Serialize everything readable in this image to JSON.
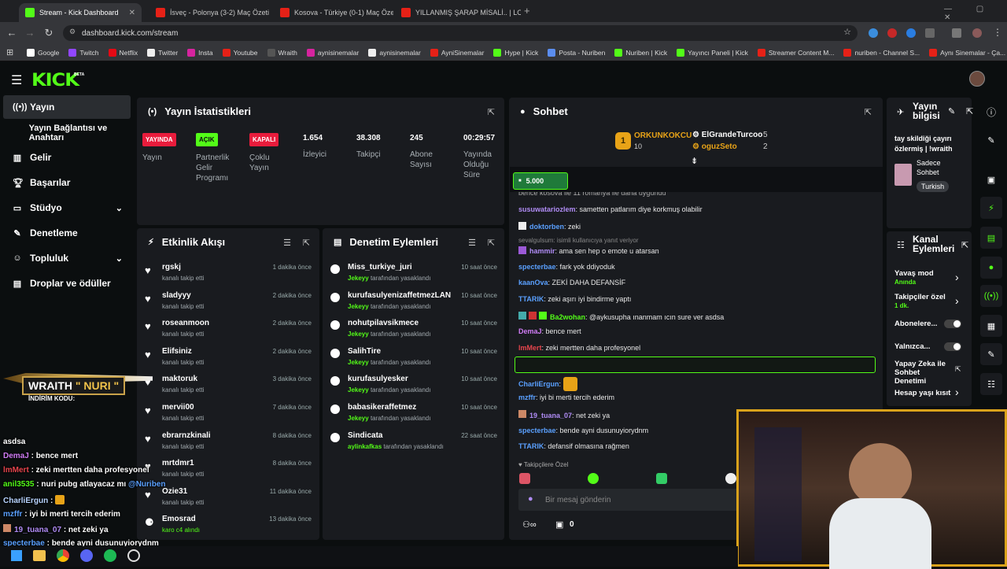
{
  "browser": {
    "tabs": [
      {
        "title": "Stream - Kick Dashboard",
        "active": true,
        "favicon": "kick-logo-icon"
      },
      {
        "title": "İsveç - Polonya (3-2) Maç Özeti",
        "active": false,
        "favicon": "youtube-icon"
      },
      {
        "title": "Kosova - Türkiye (0-1) Maç Özeti",
        "active": false,
        "favicon": "youtube-icon"
      },
      {
        "title": "YILLANMIŞ ŞARAP MİSALİ.. | LC",
        "active": false,
        "favicon": "youtube-icon"
      }
    ],
    "url": "dashboard.kick.com/stream",
    "bookmarks": [
      "Google",
      "Twitch",
      "Netflix",
      "Twitter",
      "Insta",
      "Youtube",
      "Wraith",
      "aynisinemalar",
      "aynisinemalar",
      "AyniSinemalar",
      "Hype | Kick",
      "Posta - Nuriben",
      "Nuriben | Kick",
      "Yayıncı Paneli | Kick",
      "Streamer Content M...",
      "nuriben - Channel S...",
      "Aynı Sinemalar - Ça..."
    ]
  },
  "logo": "KICK",
  "logo_beta": "BETA",
  "sidebar": {
    "items": [
      {
        "label": "Yayın",
        "icon": "broadcast-icon",
        "active": true
      },
      {
        "label": "Yayın Bağlantısı ve Anahtarı",
        "icon": "",
        "active": false
      },
      {
        "label": "Gelir",
        "icon": "chart-icon",
        "active": false
      },
      {
        "label": "Başarılar",
        "icon": "trophy-icon",
        "active": false
      },
      {
        "label": "Stüdyo",
        "icon": "studio-icon",
        "active": false,
        "chevron": true
      },
      {
        "label": "Denetleme",
        "icon": "wrench-icon",
        "active": false
      },
      {
        "label": "Topluluk",
        "icon": "users-icon",
        "active": false,
        "chevron": true
      },
      {
        "label": "Droplar ve ödüller",
        "icon": "gift-icon",
        "active": false
      }
    ]
  },
  "stats": {
    "title": "Yayın İstatistikleri",
    "badges": [
      {
        "badge": "YAYINDA",
        "label": "Yayın",
        "color": "#e81c3c"
      },
      {
        "badge": "AÇIK",
        "label": "Partnerlik Gelir Programı",
        "color": "#53fc18"
      },
      {
        "badge": "KAPALI",
        "label": "Çoklu Yayın",
        "color": "#e81c3c"
      }
    ],
    "values": [
      {
        "value": "1.654",
        "label": "İzleyici"
      },
      {
        "value": "38.308",
        "label": "Takipçi"
      },
      {
        "value": "245",
        "label": "Abone Sayısı"
      },
      {
        "value": "00:29:57",
        "label": "Yayında Olduğu Süre"
      }
    ]
  },
  "activity": {
    "title": "Etkinlik Akışı",
    "rows": [
      {
        "name": "rgskj",
        "sub": "kanalı takip etti",
        "time": "1 dakika önce"
      },
      {
        "name": "sladyyy",
        "sub": "kanalı takip etti",
        "time": "2 dakika önce"
      },
      {
        "name": "roseanmoon",
        "sub": "kanalı takip etti",
        "time": "2 dakika önce"
      },
      {
        "name": "Elifsiniz",
        "sub": "kanalı takip etti",
        "time": "2 dakika önce"
      },
      {
        "name": "maktoruk",
        "sub": "kanalı takip etti",
        "time": "3 dakika önce"
      },
      {
        "name": "mervii00",
        "sub": "kanalı takip etti",
        "time": "7 dakika önce"
      },
      {
        "name": "ebrarnzkinali",
        "sub": "kanalı takip etti",
        "time": "8 dakika önce"
      },
      {
        "name": "mrtdmr1",
        "sub": "kanalı takip etti",
        "time": "8 dakika önce"
      },
      {
        "name": "Ozie31",
        "sub": "kanalı takip etti",
        "time": "11 dakika önce"
      },
      {
        "name": "Emosrad",
        "sub": "karo c4 alındı",
        "time": "13 dakika önce"
      }
    ]
  },
  "moderation": {
    "title": "Denetim Eylemleri",
    "suffix": "tarafından yasaklandı",
    "rows": [
      {
        "name": "Miss_turkiye_juri",
        "by": "Jekeyy",
        "time": "10 saat önce"
      },
      {
        "name": "kurufasulyenizaffetmezLAN",
        "by": "Jekeyy",
        "time": "10 saat önce"
      },
      {
        "name": "nohutpilavsikmece",
        "by": "Jekeyy",
        "time": "10 saat önce"
      },
      {
        "name": "SalihTire",
        "by": "Jekeyy",
        "time": "10 saat önce"
      },
      {
        "name": "kurufasulyesker",
        "by": "Jekeyy",
        "time": "10 saat önce"
      },
      {
        "name": "babasikeraffetmez",
        "by": "Jekeyy",
        "time": "10 saat önce"
      },
      {
        "name": "Sindicata",
        "by": "aylinkafkas",
        "time": "22 saat önce"
      }
    ]
  },
  "chat": {
    "title": "Sohbet",
    "leaderboard": {
      "first": {
        "rank": "1",
        "name": "ORKUNKOKCU",
        "count": "10"
      },
      "others": [
        {
          "name": "ElGrandeTurcoo",
          "count": "5"
        },
        {
          "name": "oguzSeto",
          "count": "2"
        }
      ]
    },
    "pinned_amount": "5.000",
    "top_partial": "bence kosova ile 11 romanya ile daha uygundu",
    "reply_note": "sevalgulsum: isimli kullanıcıya yanıt veriyor",
    "messages": [
      {
        "user": "susuwatariozlem",
        "text": "sametten patlarım diye korkmuş olabilir",
        "color": "#b08cf5"
      },
      {
        "user": "doktorben",
        "text": "zeki",
        "color": "#5aa0ff"
      },
      {
        "user": "hammir",
        "text": "ama sen hep o emote u atarsan",
        "color": "#b08cf5"
      },
      {
        "user": "specterbae",
        "text": "fark yok ddiyoduk",
        "color": "#5aa0ff"
      },
      {
        "user": "kaanOva",
        "text": "ZEKİ DAHA DEFANSİF",
        "color": "#5aa0ff"
      },
      {
        "user": "TTARIK",
        "text": "zeki aşırı iyi bindirme yaptı",
        "color": "#5aa0ff"
      },
      {
        "user": "Ba2wohan",
        "text": "@aykusupha ınanmam ıcın sure ver asdsa",
        "color": "#53fc18"
      },
      {
        "user": "DemaJ",
        "text": "bence mert",
        "color": "#d07cf5"
      },
      {
        "user": "lmMert",
        "text": "zeki mertten daha profesyonel",
        "color": "#e8454d"
      },
      {
        "user": "anil3535",
        "text": "nuri pubg atlayacaz mı @Nuriben",
        "color": "#53fc18"
      },
      {
        "user": "CharliErgun",
        "text": "",
        "color": "#5aa0ff"
      },
      {
        "user": "mzffr",
        "text": "iyi bi merti tercih ederim",
        "color": "#5aa0ff"
      },
      {
        "user": "19_tuana_07",
        "text": "net zeki ya",
        "color": "#b08cf5"
      },
      {
        "user": "specterbae",
        "text": "bende ayni dusunuyiorydnm",
        "color": "#5aa0ff"
      },
      {
        "user": "TTARIK",
        "text": "defansif olmasına rağmen",
        "color": "#5aa0ff"
      }
    ],
    "followers_only": "Takipçilere Özel",
    "input_placeholder": "Bir mesaj gönderin",
    "footer_count": "0"
  },
  "stream_info": {
    "title": "Yayın bilgisi",
    "stream_title": "tay skildiği çayırı özlermiş | !wraith",
    "category": "Sadece Sohbet",
    "language": "Turkish"
  },
  "channel_actions": {
    "title": "Kanal Eylemleri",
    "items": [
      {
        "label": "Yavaş mod",
        "sub": "Anında",
        "type": "chevron"
      },
      {
        "label": "Takipçiler özel",
        "sub": "1 dk.",
        "type": "chevron"
      },
      {
        "label": "Abonelere...",
        "sub": "",
        "type": "toggle"
      },
      {
        "label": "Yalnızca...",
        "sub": "",
        "type": "toggle"
      },
      {
        "label": "Yapay Zeka ile Sohbet Denetimi",
        "sub": "",
        "type": "external"
      },
      {
        "label": "Hesap yaşı kısıt",
        "sub": "",
        "type": "chevron"
      }
    ]
  },
  "overlay": {
    "wraith_badge": "WRAITH",
    "wraith_name": "\" NURI \"",
    "wraith_code": "İNDİRİM KODU:",
    "chat_top": "asdsa",
    "chat": [
      {
        "user": "DemaJ",
        "text": " : bence mert",
        "color": "#d07cf5"
      },
      {
        "user": "lmMert",
        "text": " : zeki mertten daha profesyonel",
        "color": "#e8454d"
      },
      {
        "user": "anil3535",
        "text": " : nuri pubg atlayacaz mı ",
        "mention": "@Nuriben",
        "color": "#53fc18"
      },
      {
        "user": "CharliErgun",
        "text": " : ",
        "color": "#b8d4ff"
      },
      {
        "user": "mzffr",
        "text": " : iyi bi merti tercih ederim",
        "color": "#5aa0ff"
      },
      {
        "user": "19_tuana_07",
        "text": " : net zeki ya",
        "color": "#b08cf5"
      },
      {
        "user": "specterbae",
        "text": " : bende ayni dusunuyiorydnm",
        "color": "#5aa0ff"
      }
    ]
  },
  "colors": {
    "kick_green": "#53fc18",
    "live_red": "#e81c3c",
    "panel": "#191b1f"
  }
}
